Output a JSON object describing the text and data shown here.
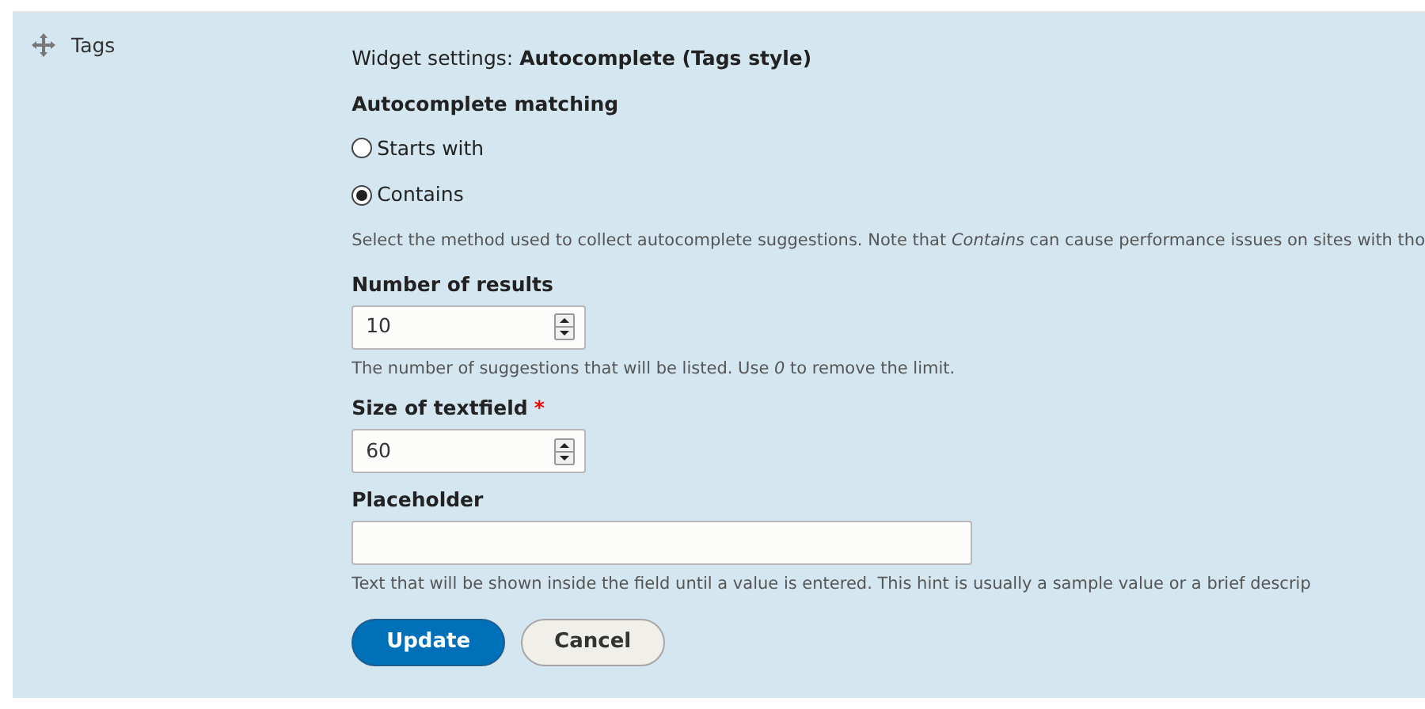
{
  "row": {
    "label": "Tags"
  },
  "settings": {
    "heading": "Widget settings: **Autocomplete (Tags style)**",
    "matching": {
      "label": "Autocomplete matching",
      "options": [
        {
          "label": "Starts with",
          "selected": false
        },
        {
          "label": "Contains",
          "selected": true
        }
      ],
      "description": "Select the method used to collect autocomplete suggestions. Note that *Contains* can cause performance issues on sites with tho"
    },
    "fields": [
      {
        "kind": "number",
        "label": "Number of results",
        "value": "10",
        "description": "The number of suggestions that will be listed. Use *0* to remove the limit."
      },
      {
        "kind": "number",
        "label": "Size of textfield",
        "required_mark": "*",
        "value": "60"
      },
      {
        "kind": "text",
        "label": "Placeholder",
        "description": "Text that will be shown inside the field until a value is entered. This hint is usually a sample value or a brief descrip"
      }
    ],
    "buttons": [
      {
        "label": "Update",
        "kind": "primary"
      },
      {
        "label": "Cancel",
        "kind": "secondary"
      }
    ]
  }
}
